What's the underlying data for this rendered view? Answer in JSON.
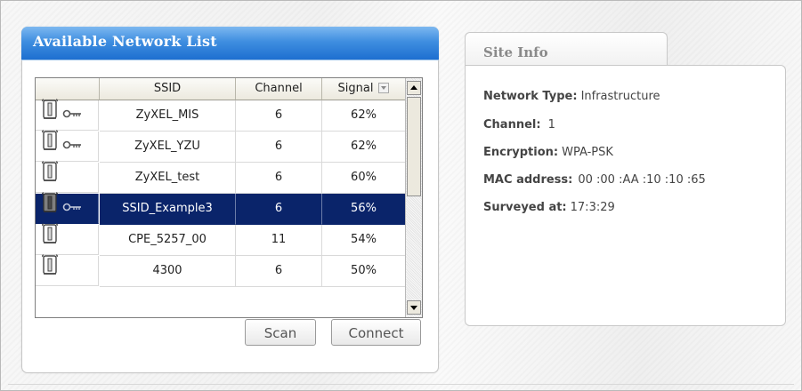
{
  "network_list": {
    "title": "Available Network List",
    "columns": [
      "",
      "SSID",
      "Channel",
      "Signal"
    ],
    "rows": [
      {
        "ssid": "ZyXEL_MIS",
        "channel": "6",
        "signal": "62%",
        "secured": true,
        "selected": false
      },
      {
        "ssid": "ZyXEL_YZU",
        "channel": "6",
        "signal": "62%",
        "secured": true,
        "selected": false
      },
      {
        "ssid": "ZyXEL_test",
        "channel": "6",
        "signal": "60%",
        "secured": false,
        "selected": false
      },
      {
        "ssid": "SSID_Example3",
        "channel": "6",
        "signal": "56%",
        "secured": true,
        "selected": true
      },
      {
        "ssid": "CPE_5257_00",
        "channel": "11",
        "signal": "54%",
        "secured": false,
        "selected": false
      },
      {
        "ssid": "4300",
        "channel": "6",
        "signal": "50%",
        "secured": false,
        "selected": false
      }
    ],
    "icons": {
      "ap": "access-point-icon",
      "key": "key-icon",
      "sort": "sort-icon"
    },
    "scan_label": "Scan",
    "connect_label": "Connect"
  },
  "site_info": {
    "tab_label": "Site Info",
    "fields": [
      {
        "label": "Network Type:",
        "value": "Infrastructure"
      },
      {
        "label": "Channel:",
        "value": "1"
      },
      {
        "label": "Encryption:",
        "value": "WPA-PSK"
      },
      {
        "label": "MAC address:",
        "value": "00 :00 :AA :10 :10 :65"
      },
      {
        "label": "Surveyed at:",
        "value": "17:3:29"
      }
    ]
  },
  "colors": {
    "title_bar": "#1d6fd0",
    "selected_row": "#0a246a",
    "header_bg": "#ece9de"
  }
}
